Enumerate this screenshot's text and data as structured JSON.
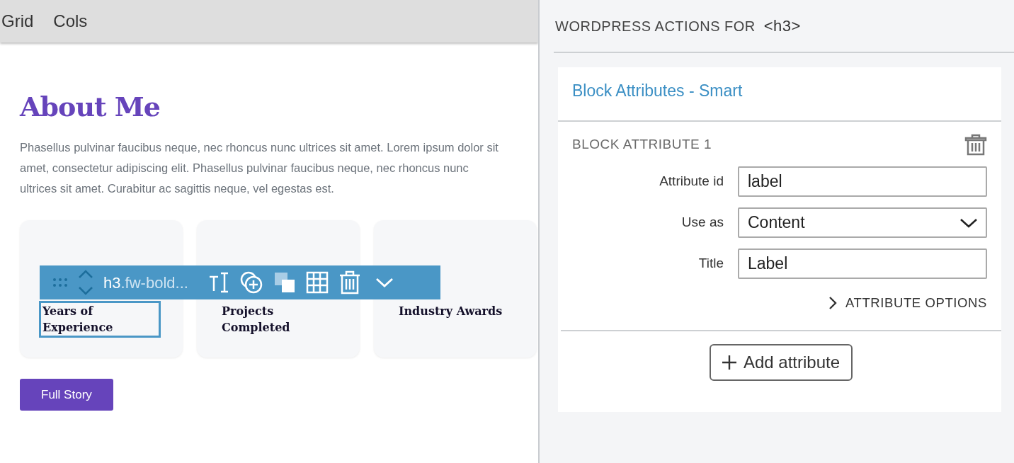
{
  "editor_tabs": [
    {
      "label": "Grid"
    },
    {
      "label": "Cols"
    }
  ],
  "content": {
    "heading": "About Me",
    "paragraph": "Phasellus pulvinar faucibus neque, nec rhoncus nunc ultrices sit amet. Lorem ipsum dolor sit amet, consectetur adipiscing elit. Phasellus pulvinar faucibus neque, nec rhoncus nunc ultrices sit amet. Curabitur ac sagittis neque, vel egestas est.",
    "stats": [
      {
        "label": "Years of Experience",
        "selected": true
      },
      {
        "label": "Projects Completed",
        "selected": false
      },
      {
        "label": "Industry Awards",
        "selected": false
      }
    ],
    "button": "Full Story"
  },
  "block_toolbar": {
    "element": "h3",
    "classes": ".fw-bold..."
  },
  "panel": {
    "title": "WORDPRESS ACTIONS FOR",
    "tag": "<h3>",
    "card_title": "Block Attributes - Smart",
    "attributes": [
      {
        "heading": "BLOCK ATTRIBUTE 1",
        "fields": [
          {
            "label": "Attribute id",
            "kind": "text",
            "value": "label"
          },
          {
            "label": "Use as",
            "kind": "select",
            "value": "Content"
          },
          {
            "label": "Title",
            "kind": "text",
            "value": "Label"
          }
        ],
        "options_link": "ATTRIBUTE OPTIONS",
        "options_expanded": false
      }
    ],
    "add_button": "Add attribute"
  }
}
